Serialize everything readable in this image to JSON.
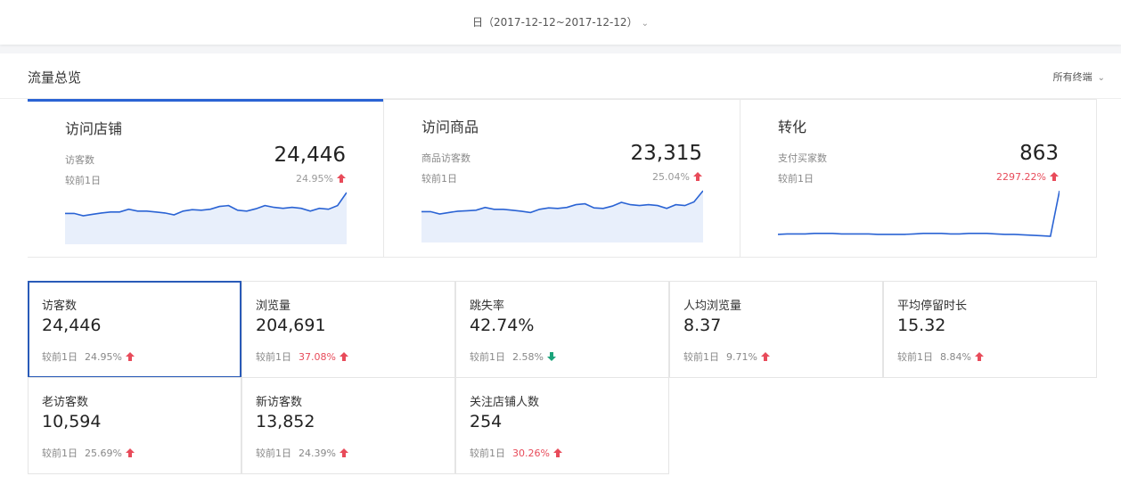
{
  "header": {
    "date_range": "日（2017-12-12~2017-12-12）"
  },
  "panel": {
    "title": "流量总览",
    "terminal": "所有终端"
  },
  "cards": [
    {
      "title": "访问店铺",
      "sub": "访客数",
      "compare": "较前1日",
      "value": "24,446",
      "pct": "24.95%",
      "pct_color": "gray",
      "trend": "up",
      "spark": [
        0.55,
        0.55,
        0.5,
        0.53,
        0.56,
        0.58,
        0.58,
        0.64,
        0.6,
        0.6,
        0.58,
        0.56,
        0.52,
        0.6,
        0.63,
        0.62,
        0.64,
        0.7,
        0.72,
        0.62,
        0.6,
        0.65,
        0.72,
        0.68,
        0.66,
        0.68,
        0.66,
        0.6,
        0.66,
        0.64,
        0.72,
        1.0
      ]
    },
    {
      "title": "访问商品",
      "sub": "商品访客数",
      "compare": "较前1日",
      "value": "23,315",
      "pct": "25.04%",
      "pct_color": "gray",
      "trend": "up",
      "spark": [
        0.55,
        0.55,
        0.5,
        0.53,
        0.56,
        0.57,
        0.58,
        0.64,
        0.6,
        0.6,
        0.58,
        0.56,
        0.53,
        0.6,
        0.63,
        0.62,
        0.64,
        0.7,
        0.72,
        0.63,
        0.62,
        0.67,
        0.75,
        0.7,
        0.68,
        0.7,
        0.68,
        0.62,
        0.7,
        0.68,
        0.76,
        1.0
      ]
    },
    {
      "title": "转化",
      "sub": "支付买家数",
      "compare": "较前1日",
      "value": "863",
      "pct": "2297.22%",
      "pct_color": "red",
      "trend": "up",
      "spark": [
        0.06,
        0.07,
        0.07,
        0.07,
        0.08,
        0.08,
        0.08,
        0.07,
        0.07,
        0.07,
        0.07,
        0.06,
        0.06,
        0.06,
        0.06,
        0.07,
        0.08,
        0.08,
        0.08,
        0.07,
        0.07,
        0.08,
        0.08,
        0.08,
        0.07,
        0.06,
        0.06,
        0.05,
        0.04,
        0.03,
        0.02,
        1.0
      ]
    }
  ],
  "metrics": [
    {
      "label": "访客数",
      "value": "24,446",
      "compare": "较前1日",
      "pct": "24.95%",
      "pct_color": "gray",
      "trend": "up"
    },
    {
      "label": "浏览量",
      "value": "204,691",
      "compare": "较前1日",
      "pct": "37.08%",
      "pct_color": "red",
      "trend": "up"
    },
    {
      "label": "跳失率",
      "value": "42.74%",
      "compare": "较前1日",
      "pct": "2.58%",
      "pct_color": "gray",
      "trend": "down"
    },
    {
      "label": "人均浏览量",
      "value": "8.37",
      "compare": "较前1日",
      "pct": "9.71%",
      "pct_color": "gray",
      "trend": "up"
    },
    {
      "label": "平均停留时长",
      "value": "15.32",
      "compare": "较前1日",
      "pct": "8.84%",
      "pct_color": "gray",
      "trend": "up"
    },
    {
      "label": "老访客数",
      "value": "10,594",
      "compare": "较前1日",
      "pct": "25.69%",
      "pct_color": "gray",
      "trend": "up"
    },
    {
      "label": "新访客数",
      "value": "13,852",
      "compare": "较前1日",
      "pct": "24.39%",
      "pct_color": "gray",
      "trend": "up"
    },
    {
      "label": "关注店铺人数",
      "value": "254",
      "compare": "较前1日",
      "pct": "30.26%",
      "pct_color": "red",
      "trend": "up"
    }
  ],
  "colors": {
    "accent": "#2a63d4",
    "up": "#e84b5a",
    "down": "#1aa37a",
    "spark_line": "#2a63d4",
    "spark_fill": "#e8effb"
  }
}
